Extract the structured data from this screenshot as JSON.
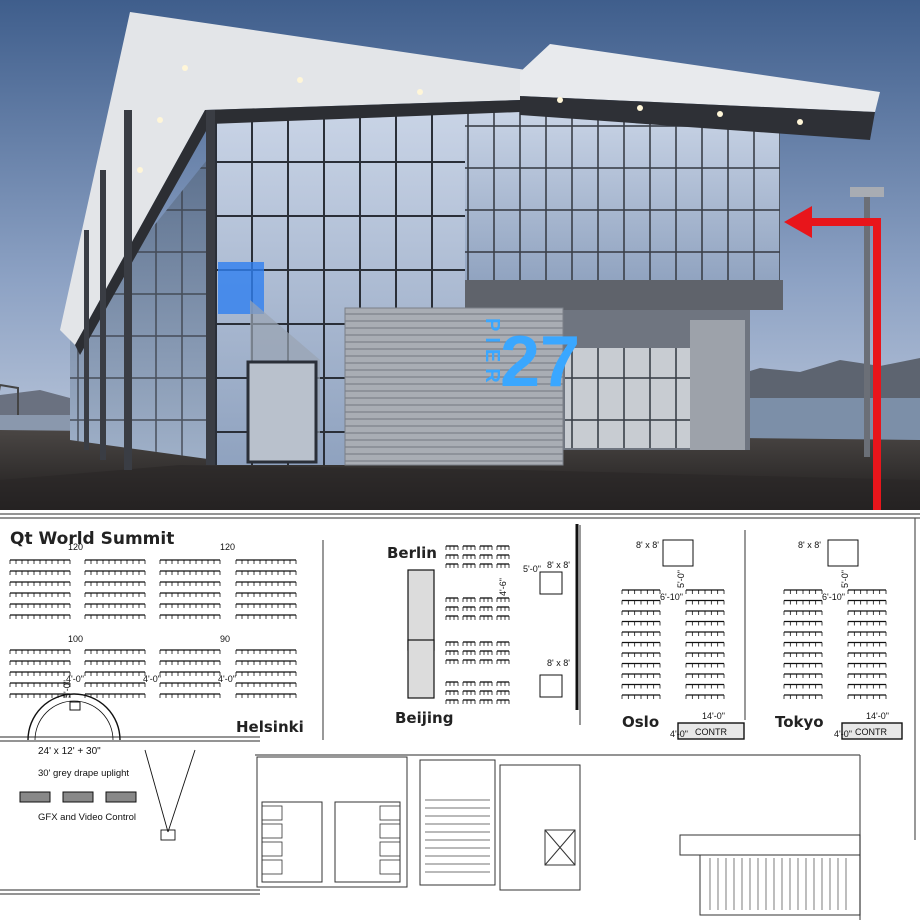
{
  "photo": {
    "building_sign": {
      "vertical": "PIER",
      "number": "27"
    }
  },
  "plan": {
    "event_title": "Qt World Summit",
    "rooms": {
      "helsinki": "Helsinki",
      "berlin": "Berlin",
      "beijing": "Beijing",
      "oslo": "Oslo",
      "tokyo": "Tokyo"
    },
    "seat_counts": [
      "120",
      "120",
      "100",
      "90"
    ],
    "stage_label": "24' x 12' + 30\"",
    "drape_label": "30' grey drape uplight",
    "control_label": "GFX and Video Control",
    "dimensions": {
      "aisle_a": "4'-0\"",
      "aisle_b": "4'-0\"",
      "aisle_c": "4'-0\"",
      "stage_gap": "5'-0\"",
      "berlin_gap": "5'-0\"",
      "berlin_screen_1": "8' x 8'",
      "berlin_screen_2": "8' x 8'",
      "berlin_side": "4'-6\"",
      "oslo_screen": "8' x 8'",
      "oslo_gap": "5'-0\"",
      "oslo_aisle": "6'-10\"",
      "tokyo_screen": "8' x 8'",
      "tokyo_gap": "5'-0\"",
      "tokyo_aisle": "6'-10\"",
      "oslo_table": "14'-0\"",
      "tokyo_table": "14'-0\"",
      "oslo_depth": "4'-0\"",
      "tokyo_depth": "4'-0\""
    },
    "control_tag": "CONTR"
  },
  "colors": {
    "arrow": "#e8151b",
    "sign_blue": "#3aa7ff",
    "sky_top": "#3f5e8c",
    "sky_bottom": "#b9c6dc"
  }
}
